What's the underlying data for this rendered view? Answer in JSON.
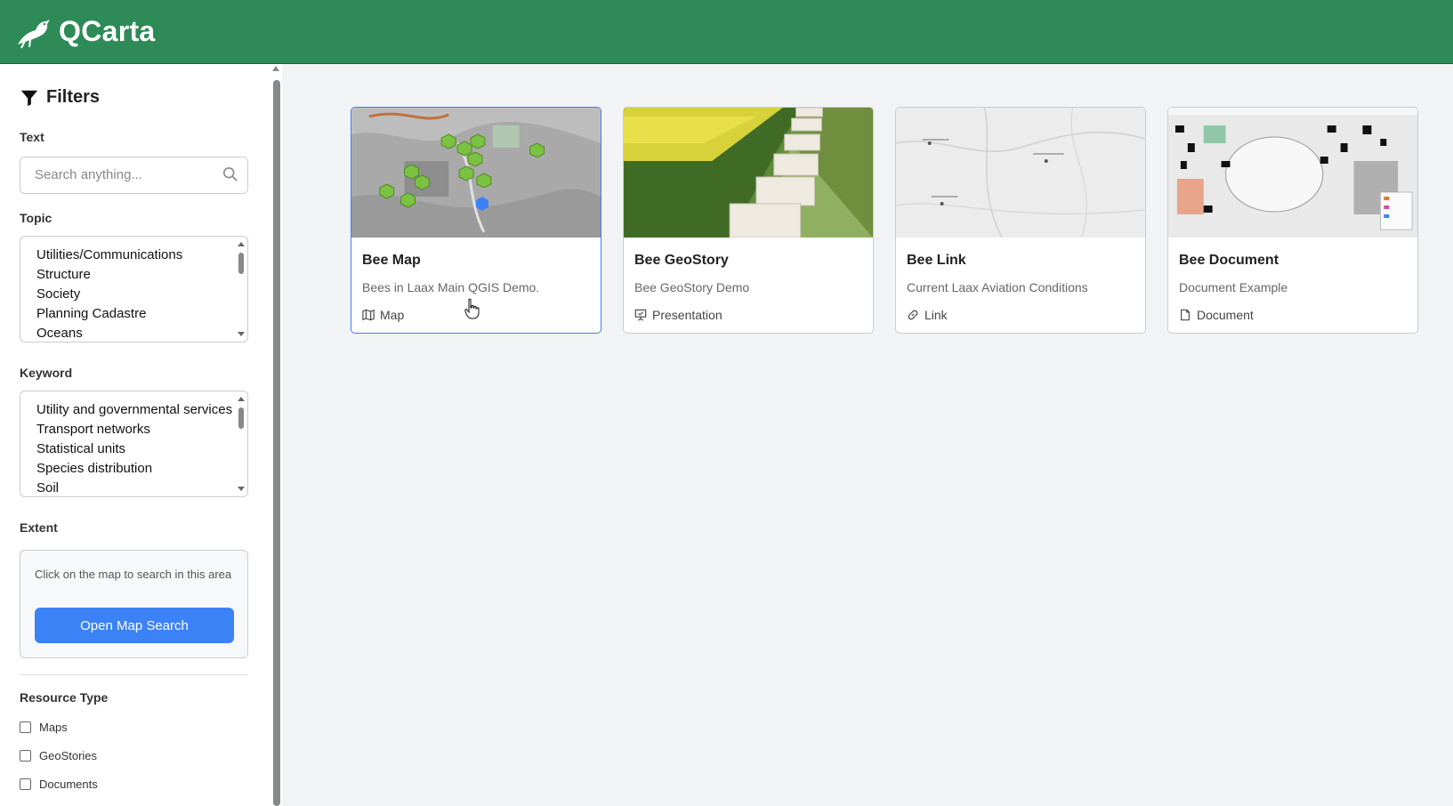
{
  "app": {
    "title": "QCarta"
  },
  "sidebar": {
    "title": "Filters",
    "text_label": "Text",
    "search_placeholder": "Search anything...",
    "topic_label": "Topic",
    "topics": [
      "Utilities/Communications",
      "Structure",
      "Society",
      "Planning Cadastre",
      "Oceans"
    ],
    "keyword_label": "Keyword",
    "keywords": [
      "Utility and governmental services",
      "Transport networks",
      "Statistical units",
      "Species distribution",
      "Soil"
    ],
    "extent_label": "Extent",
    "extent_text": "Click on the map to search in this area",
    "map_button": "Open Map Search",
    "resource_type_label": "Resource Type",
    "resource_types": [
      "Maps",
      "GeoStories",
      "Documents"
    ]
  },
  "cards": [
    {
      "title": "Bee Map",
      "description": "Bees in Laax Main QGIS Demo.",
      "type": "Map",
      "type_icon": "map-icon",
      "selected": true
    },
    {
      "title": "Bee GeoStory",
      "description": "Bee GeoStory Demo",
      "type": "Presentation",
      "type_icon": "presentation-icon"
    },
    {
      "title": "Bee Link",
      "description": "Current Laax Aviation Conditions",
      "type": "Link",
      "type_icon": "link-icon"
    },
    {
      "title": "Bee Document",
      "description": "Document Example",
      "type": "Document",
      "type_icon": "document-icon"
    }
  ],
  "colors": {
    "brand": "#2e8b57",
    "accent": "#3b82f6",
    "background": "#f2f3f5"
  }
}
